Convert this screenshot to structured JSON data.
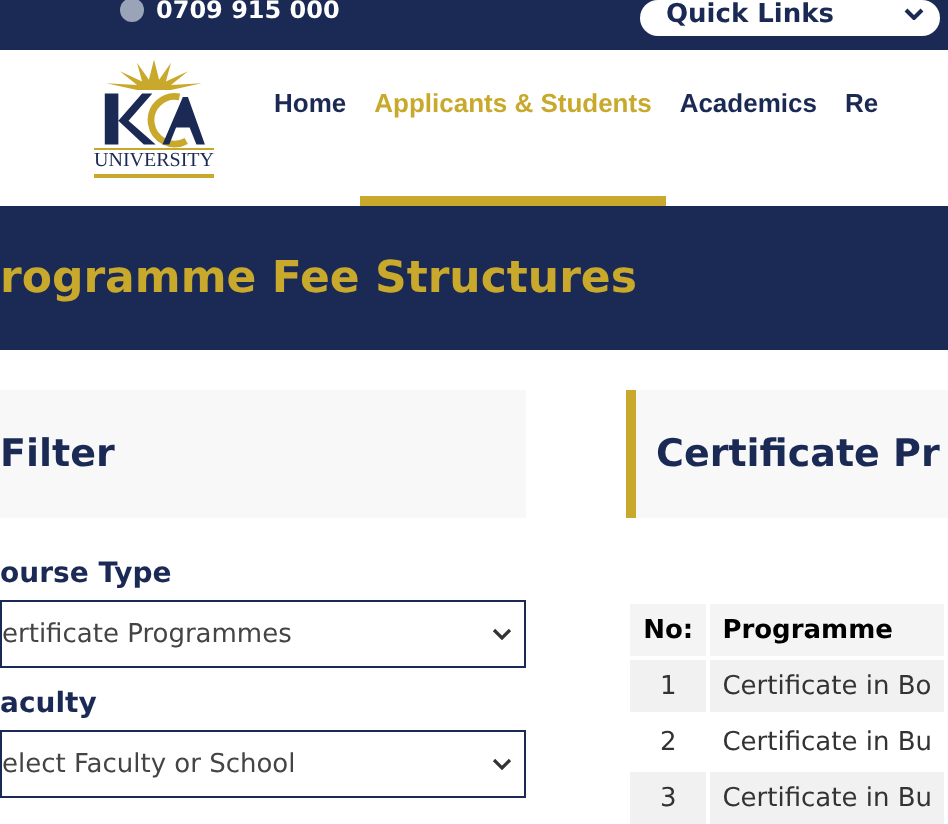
{
  "top_bar": {
    "phone": "0709 915 000",
    "quick_links": "Quick Links"
  },
  "logo": {
    "name": "UNIVERSITY"
  },
  "nav": [
    {
      "label": "Home",
      "selected": false
    },
    {
      "label": "Applicants & Students",
      "selected": true
    },
    {
      "label": "Academics",
      "selected": false
    },
    {
      "label": "Re",
      "selected": false
    }
  ],
  "page_title": "rogramme Fee Structures",
  "filter": {
    "title": "Filter",
    "fields": [
      {
        "label": "ourse Type",
        "value": "ertificate Programmes"
      },
      {
        "label": "aculty",
        "value": "elect Faculty or School"
      }
    ]
  },
  "results": {
    "title": "Certificate Pr",
    "columns": [
      "No:",
      "Programme"
    ],
    "rows": [
      [
        "1",
        "Certificate in Bo"
      ],
      [
        "2",
        "Certificate in Bu"
      ],
      [
        "3",
        "Certificate in Bu"
      ]
    ]
  }
}
